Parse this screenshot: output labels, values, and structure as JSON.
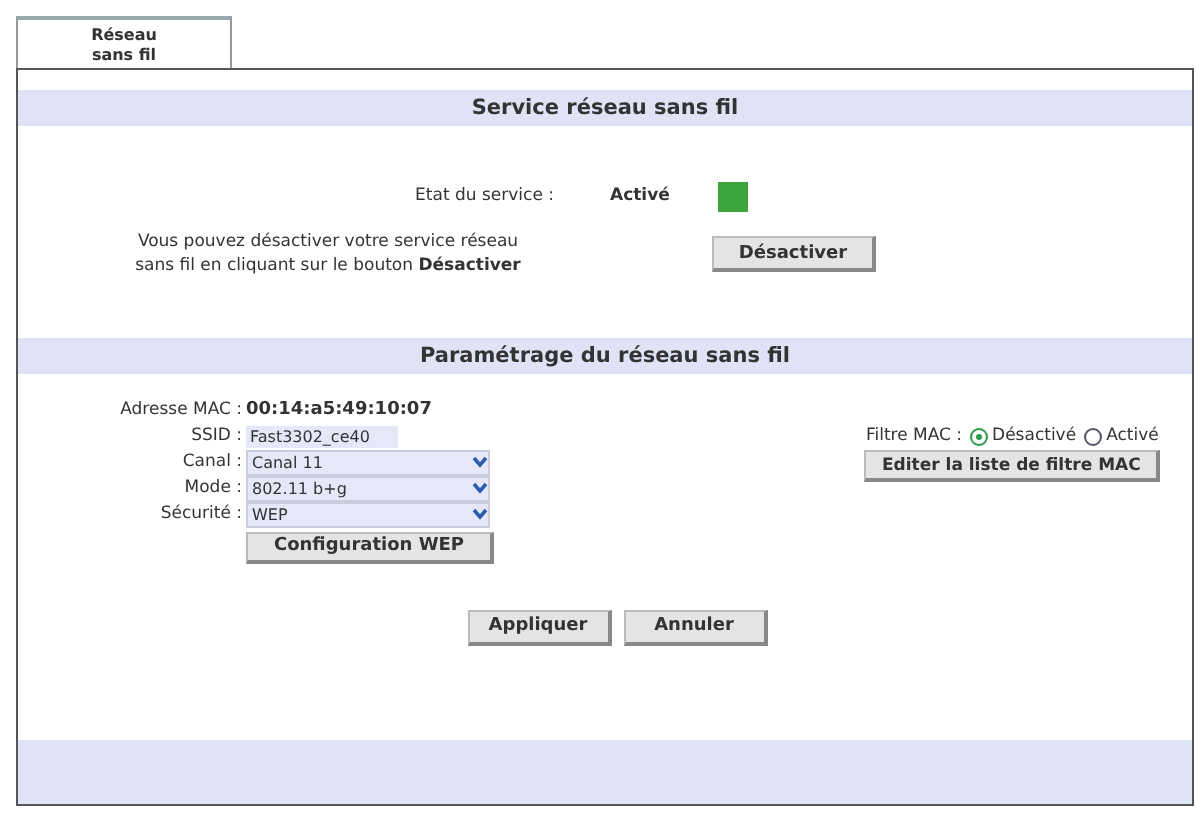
{
  "tabs": [
    {
      "label": "Réseau\nsans fil",
      "selected": true
    }
  ],
  "service": {
    "title": "Service réseau sans fil",
    "state_label": "Etat du service :",
    "state_value": "Activé",
    "state_on": true,
    "description": "Vous pouvez désactiver votre service réseau\nsans fil en cliquant sur le bouton **Désactiver**",
    "button": "Désactiver"
  },
  "settings": {
    "title": "Paramétrage du réseau sans fil",
    "mac_label": "Adresse MAC :",
    "mac_value": "00:14:a5:49:10:07",
    "fields": [
      {
        "kind": "input",
        "label": "SSID :",
        "value": "Fast3302_ce40"
      },
      {
        "kind": "select",
        "label": "Canal :",
        "value": "Canal 11"
      },
      {
        "kind": "select",
        "label": "Mode :",
        "value": "802.11 b+g"
      },
      {
        "kind": "select",
        "label": "Sécurité :",
        "value": "WEP"
      }
    ],
    "wep_button": "Configuration WEP",
    "mac_filter_label": "Filtre MAC :",
    "mac_filter_options": [
      {
        "label": "Désactivé",
        "selected": true
      },
      {
        "label": "Activé",
        "selected": false
      }
    ],
    "mac_filter_button": "Editer la liste de filtre MAC"
  },
  "actions": [
    "Appliquer",
    "Annuler"
  ]
}
